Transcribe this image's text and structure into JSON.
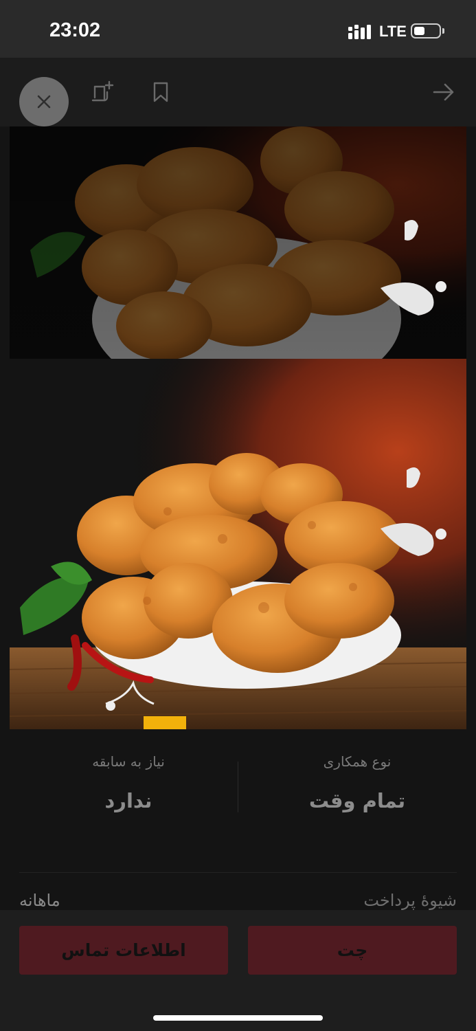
{
  "status_bar": {
    "time": "23:02",
    "network": "LTE",
    "battery_level": 0.45
  },
  "toolbar": {
    "icons": [
      "close-icon",
      "add-note-icon",
      "bookmark-icon",
      "arrow-right-icon"
    ]
  },
  "hero_image": {
    "description_icon": "fried-chicken-photo"
  },
  "details": {
    "cooperation_type": {
      "label": "نوع همکاری",
      "value": "تمام وقت"
    },
    "experience_needed": {
      "label": "نیاز به سابقه",
      "value": "ندارد"
    },
    "payment": {
      "label": "شیوهٔ پرداخت",
      "value": "ماهانه"
    }
  },
  "actions": {
    "chat_label": "چت",
    "contact_label": "اطلاعات تماس"
  },
  "colors": {
    "action_button": "#4f1a20",
    "background": "#141414",
    "status_bar": "#2a2a2a"
  }
}
